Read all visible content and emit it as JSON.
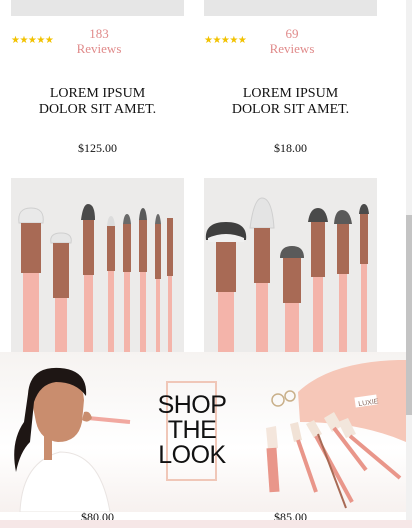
{
  "products": [
    {
      "stars": "★★★★★",
      "reviews_count": "183",
      "reviews_label": "Reviews",
      "title_line1": "LOREM IPSUM",
      "title_line2": "DOLOR SIT AMET.",
      "price": "$125.00"
    },
    {
      "stars": "★★★★★",
      "reviews_count": "69",
      "reviews_label": "Reviews",
      "title_line1": "LOREM IPSUM",
      "title_line2": "DOLOR SIT AMET.",
      "price": "$18.00"
    }
  ],
  "banner": {
    "line1": "SHOP",
    "line2": "THE",
    "line3": "LOOK",
    "pouch_label": "LUXIE"
  },
  "bottom_prices": [
    "$80.00",
    "$85.00"
  ],
  "colors": {
    "accent_pink": "#e08a8a",
    "star_gold": "#f2c200",
    "brush_handle": "#f4b4aa",
    "ferrule_rose_gold": "#a86a55"
  }
}
